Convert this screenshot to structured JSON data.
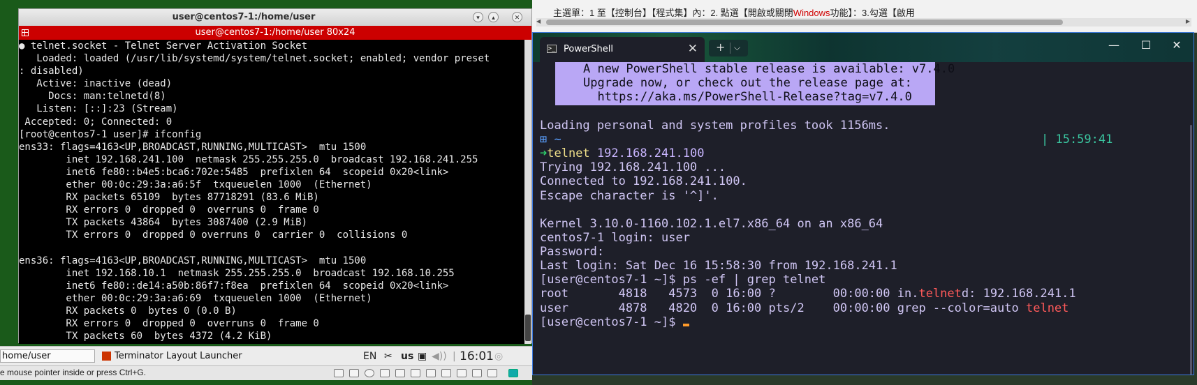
{
  "vm": {
    "window_title": "user@centos7-1:/home/user",
    "terminal_title": "user@centos7-1:/home/user 80x24",
    "terminal_lines": [
      "● telnet.socket - Telnet Server Activation Socket",
      "   Loaded: loaded (/usr/lib/systemd/system/telnet.socket; enabled; vendor preset",
      ": disabled)",
      "   Active: inactive (dead)",
      "     Docs: man:telnetd(8)",
      "   Listen: [::]:23 (Stream)",
      " Accepted: 0; Connected: 0",
      "[root@centos7-1 user]# ifconfig",
      "ens33: flags=4163<UP,BROADCAST,RUNNING,MULTICAST>  mtu 1500",
      "        inet 192.168.241.100  netmask 255.255.255.0  broadcast 192.168.241.255",
      "        inet6 fe80::b4e5:bca6:702e:5485  prefixlen 64  scopeid 0x20<link>",
      "        ether 00:0c:29:3a:a6:5f  txqueuelen 1000  (Ethernet)",
      "        RX packets 65109  bytes 87718291 (83.6 MiB)",
      "        RX errors 0  dropped 0  overruns 0  frame 0",
      "        TX packets 43864  bytes 3087400 (2.9 MiB)",
      "        TX errors 0  dropped 0 overruns 0  carrier 0  collisions 0",
      "",
      "ens36: flags=4163<UP,BROADCAST,RUNNING,MULTICAST>  mtu 1500",
      "        inet 192.168.10.1  netmask 255.255.255.0  broadcast 192.168.10.255",
      "        inet6 fe80::de14:a50b:86f7:f8ea  prefixlen 64  scopeid 0x20<link>",
      "        ether 00:0c:29:3a:a6:69  txqueuelen 1000  (Ethernet)",
      "        RX packets 0  bytes 0 (0.0 B)",
      "        RX errors 0  dropped 0  overruns 0  frame 0",
      "        TX packets 60  bytes 4372 (4.2 KiB)"
    ],
    "taskbar": {
      "path_item": "home/user",
      "launcher_item": "Terminator Layout Launcher",
      "lang": "EN",
      "kb": "us",
      "clock": "16:01"
    },
    "status_text": "e mouse pointer inside or press Ctrl+G."
  },
  "browser": {
    "text_before": "主選單：1 至【控制台】【程式集】內：2. 點選【開啟或關閉",
    "text_highlight": "Windows",
    "text_after": "功能】：3.勾選【啟用"
  },
  "powershell": {
    "tab_title": "PowerShell",
    "banner_lines": [
      "A new PowerShell stable release is available: v7.4.0",
      "Upgrade now, or check out the release page at:",
      "  https://aka.ms/PowerShell-Release?tag=v7.4.0"
    ],
    "profiles_line": "Loading personal and system profiles took 1156ms.",
    "prompt_dir": "~",
    "prompt_time": "| 15:59:41",
    "prompt_arrow": "➜",
    "cmd_name": "telnet",
    "cmd_arg": " 192.168.241.100",
    "trying": "Trying 192.168.241.100 ...",
    "connected": "Connected to 192.168.241.100.",
    "escape": "Escape character is '^]'.",
    "kernel": "Kernel 3.10.0-1160.102.1.el7.x86_64 on an x86_64",
    "login": "centos7-1 login: user",
    "password": "Password:",
    "last_login": "Last login: Sat Dec 16 15:58:30 from 192.168.241.1",
    "ps_cmd": "[user@centos7-1 ~]$ ps -ef | grep telnet",
    "row1_pre": "root       4818   4573  0 16:00 ?        00:00:00 in.",
    "row1_hl": "telnet",
    "row1_post": "d: 192.168.241.1",
    "row2_pre": "user       4878   4820  0 16:00 pts/2    00:00:00 grep --color=auto ",
    "row2_hl": "telnet",
    "final_prompt": "[user@centos7-1 ~]$ "
  }
}
